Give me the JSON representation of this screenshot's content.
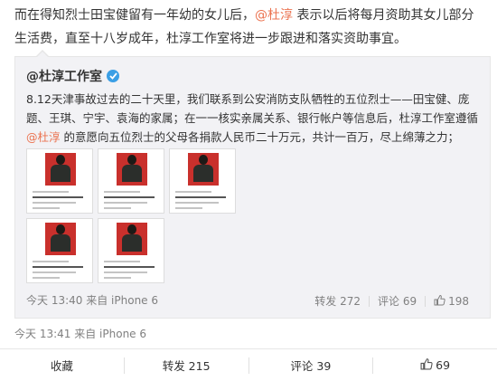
{
  "post": {
    "text_before_mention": "而在得知烈士田宝健留有一年幼的女儿后，",
    "mention": "@杜淳",
    "text_after_mention": " 表示以后将每月资助其女儿部分生活费，直至十八岁成年，杜淳工作室将进一步跟进和落实资助事宜。"
  },
  "quote": {
    "author": "@杜淳工作室",
    "verified_icon": "verified-badge-icon",
    "body_before_mention": "8.12天津事故过去的二十天里，我们联系到公安消防支队牺牲的五位烈士——田宝健、庞题、王琪、宁宇、袁海的家属；在一一核实亲属关系、银行帐户等信息后，杜淳工作室遵循",
    "mention": "@杜淳",
    "body_after_mention": " 的意愿向五位烈士的父母各捐款人民币二十万元，共计一百万，尽上绵薄之力；",
    "images_count": 5,
    "time": "今天 13:40",
    "source": "来自 iPhone 6",
    "repost_label": "转发 272",
    "comment_label": "评论 69",
    "like_count": "198"
  },
  "original": {
    "time": "今天 13:41",
    "source": "来自 iPhone 6"
  },
  "bottom_bar": {
    "favorite_label": "收藏",
    "repost_label": "转发 215",
    "comment_label": "评论 39",
    "like_count": "69"
  },
  "colors": {
    "link": "#eb7350",
    "verified": "#3b9fe5",
    "quote_bg": "#f2f2f5"
  }
}
